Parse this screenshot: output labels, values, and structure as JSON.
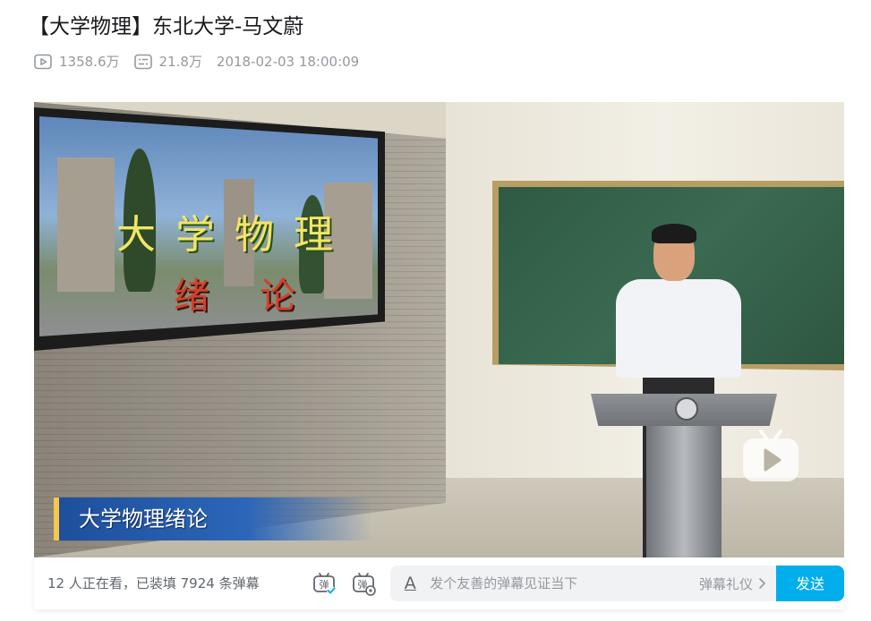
{
  "video": {
    "title": "【大学物理】东北大学-马文蔚",
    "stats": {
      "plays": "1358.6万",
      "danmaku": "21.8万",
      "publish_time": "2018-02-03 18:00:09"
    }
  },
  "player": {
    "screen_title": "大学物理",
    "screen_subtitle": "绪论",
    "caption": "大学物理绪论",
    "play_icon": "play-icon"
  },
  "danmaku_bar": {
    "info": "12 人正在看，已装填 7924 条弹幕",
    "toggle_icon": "danmaku-toggle-icon",
    "settings_icon": "danmaku-settings-icon",
    "style_icon": "A",
    "placeholder": "发个友善的弹幕见证当下",
    "etiquette": "弹幕礼仪",
    "send": "发送"
  },
  "colors": {
    "accent": "#00aeec",
    "text_primary": "#18191c",
    "text_secondary": "#9499a0"
  }
}
